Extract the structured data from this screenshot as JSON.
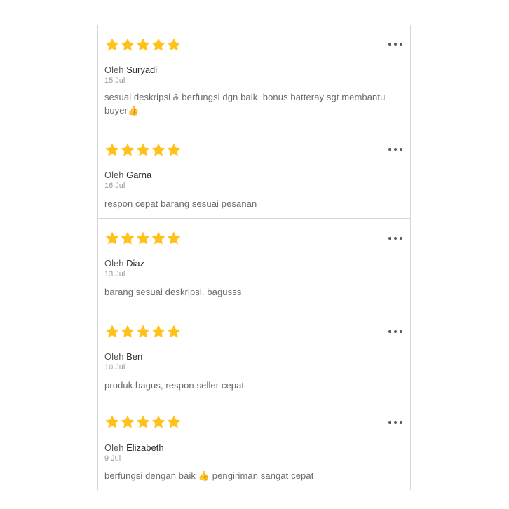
{
  "colors": {
    "star": "#FFC21A",
    "text_primary": "#2d2d2d",
    "text_secondary": "#6a6a6a",
    "text_muted": "#9a9a9a",
    "border": "#d6d6d6"
  },
  "icons": {
    "rating": "star-icon",
    "menu": "more-horizontal-icon"
  },
  "reviews": [
    {
      "rating": 5,
      "by_prefix": "Oleh",
      "author": "Suryadi",
      "date": "15 Jul",
      "comment": "sesuai deskripsi & berfungsi dgn baik. bonus batteray sgt membantu buyer👍"
    },
    {
      "rating": 5,
      "by_prefix": "Oleh",
      "author": "Garna",
      "date": "16 Jul",
      "comment": "respon cepat barang sesuai pesanan"
    },
    {
      "rating": 5,
      "by_prefix": "Oleh",
      "author": "Diaz",
      "date": "13 Jul",
      "comment": "barang sesuai deskripsi. bagusss"
    },
    {
      "rating": 5,
      "by_prefix": "Oleh",
      "author": "Ben",
      "date": "10 Jul",
      "comment": "produk bagus, respon seller cepat"
    },
    {
      "rating": 5,
      "by_prefix": "Oleh",
      "author": "Elizabeth",
      "date": "9 Jul",
      "comment": "berfungsi dengan baik 👍 pengiriman sangat cepat"
    }
  ]
}
